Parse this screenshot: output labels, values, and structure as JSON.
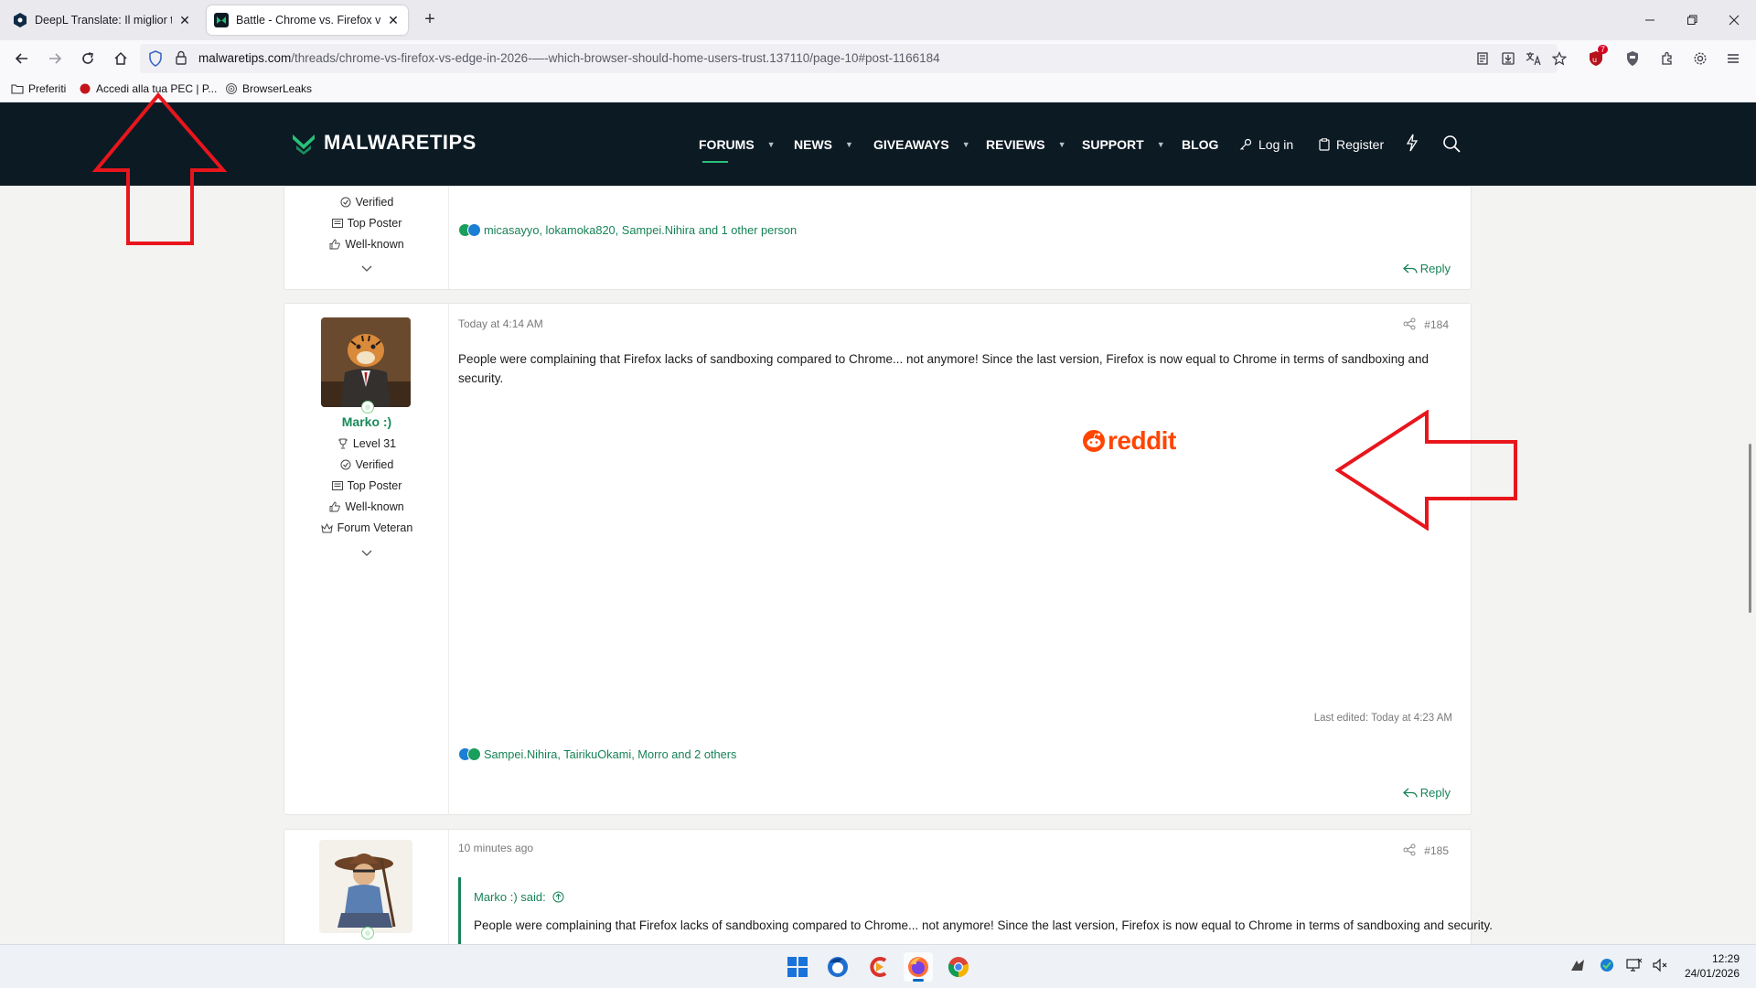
{
  "browser": {
    "tabs": [
      {
        "label": "DeepL Translate: Il miglior tradu",
        "active": false
      },
      {
        "label": "Battle - Chrome vs. Firefox vs. E",
        "active": true
      }
    ],
    "new_tab": "+",
    "url_domain": "malwaretips.com",
    "url_path": "/threads/chrome-vs-firefox-vs-edge-in-2026-—-which-browser-should-home-users-trust.137110/page-10#post-1166184",
    "extension_badge": "7",
    "bookmarks": [
      {
        "label": "Preferiti",
        "icon": "folder-icon"
      },
      {
        "label": "Accedi alla tua PEC | P...",
        "icon": "red-dot-icon"
      },
      {
        "label": "BrowserLeaks",
        "icon": "fingerprint-icon"
      }
    ]
  },
  "site": {
    "logo_text": "MALWARETIPS",
    "nav": {
      "forums": "FORUMS",
      "news": "NEWS",
      "giveaways": "GIVEAWAYS",
      "reviews": "REVIEWS",
      "support": "SUPPORT",
      "blog": "BLOG",
      "login": "Log in",
      "register": "Register"
    }
  },
  "posts": {
    "prev": {
      "badges": [
        "Verified",
        "Top Poster",
        "Well-known"
      ],
      "reactions": "micasayyo, lokamoka820, Sampei.Nihira and 1 other person",
      "reply": "Reply"
    },
    "p184": {
      "time": "Today at 4:14 AM",
      "number": "#184",
      "author": "Marko :)",
      "badges": [
        "Level 31",
        "Verified",
        "Top Poster",
        "Well-known",
        "Forum Veteran"
      ],
      "text": "People were complaining that Firefox lacks of sandboxing compared to Chrome... not anymore! Since the last version, Firefox is now equal to Chrome in terms of sandboxing and security.",
      "embed": "reddit",
      "last_edited": "Last edited: Today at 4:23 AM",
      "reactions": "Sampei.Nihira, TairikuOkami, Morro and 2 others",
      "reply": "Reply"
    },
    "p185": {
      "time": "10 minutes ago",
      "number": "#185",
      "quote_author": "Marko :) said:",
      "quote_text": "People were complaining that Firefox lacks of sandboxing compared to Chrome... not anymore! Since the last version, Firefox is now equal to Chrome in terms of sandboxing and security."
    }
  },
  "taskbar": {
    "time": "12:29",
    "date": "24/01/2026"
  },
  "colors": {
    "header_bg": "#0c1a24",
    "accent_green": "#178357",
    "annotation_red": "#e8161c",
    "reddit_orange": "#ff4500"
  }
}
